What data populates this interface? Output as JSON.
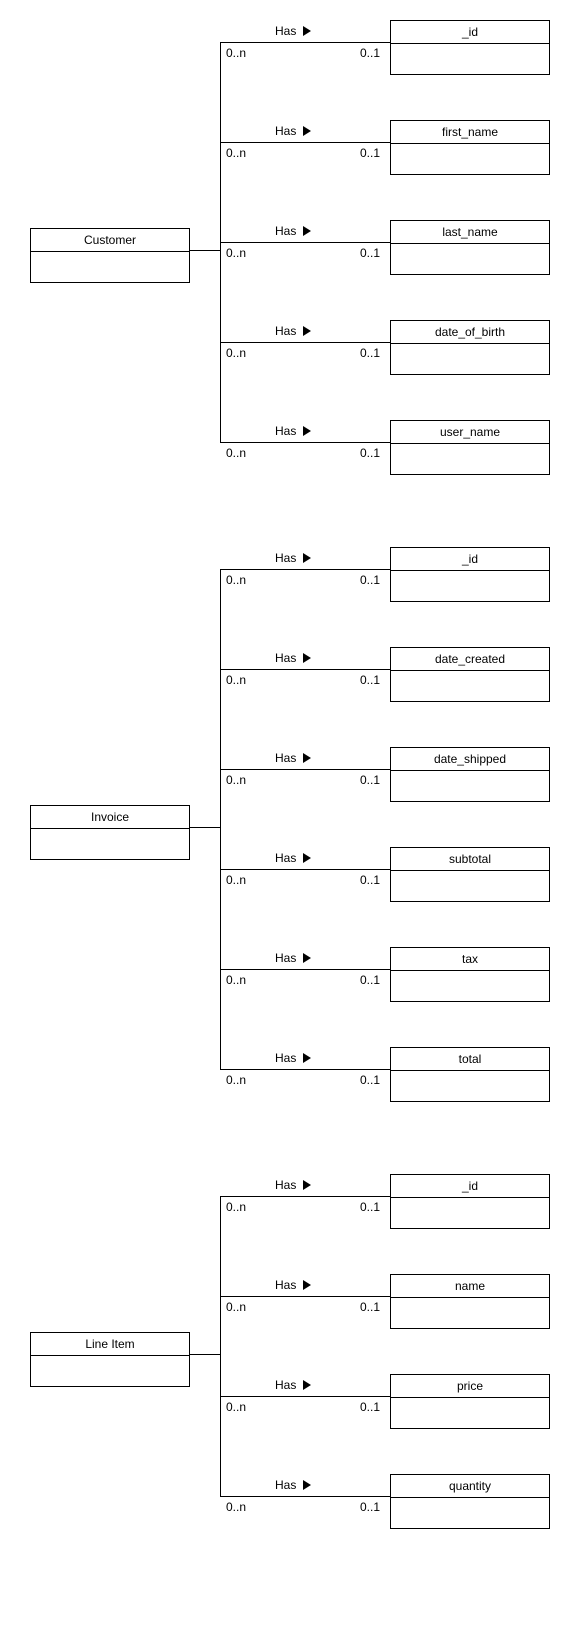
{
  "rel_label": "Has",
  "mult_left": "0..n",
  "mult_right": "0..1",
  "entities": [
    {
      "name": "Customer",
      "attributes": [
        "_id",
        "first_name",
        "last_name",
        "date_of_birth",
        "user_name"
      ]
    },
    {
      "name": "Invoice",
      "attributes": [
        "_id",
        "date_created",
        "date_shipped",
        "subtotal",
        "tax",
        "total"
      ]
    },
    {
      "name": "Line Item",
      "attributes": [
        "_id",
        "name",
        "price",
        "quantity"
      ]
    }
  ]
}
